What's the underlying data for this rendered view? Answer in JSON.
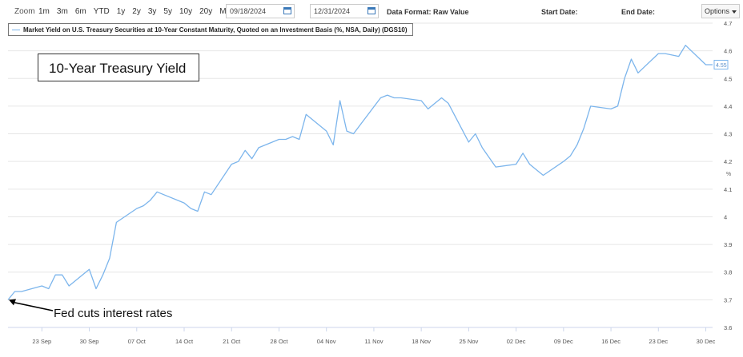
{
  "toolbar": {
    "zoom_label": "Zoom",
    "zoom_buttons": [
      "1m",
      "3m",
      "6m",
      "YTD",
      "1y",
      "2y",
      "3y",
      "5y",
      "10y",
      "20y",
      "Max"
    ],
    "start_date_value": "09/18/2024",
    "end_date_value": "12/31/2024",
    "data_format_label": "Data Format: Raw Value",
    "start_date_label": "Start Date:",
    "end_date_label": "End Date:",
    "options_label": "Options"
  },
  "annotations": {
    "title_box": "10-Year Treasury Yield",
    "fed_note": "Fed cuts interest rates"
  },
  "chart_data": {
    "type": "line",
    "title": "",
    "xlabel": "",
    "ylabel": "%",
    "ylim": [
      3.6,
      4.7
    ],
    "xlim": [
      "2024-09-18",
      "2024-12-31"
    ],
    "yticks": [
      "3.6",
      "3.7",
      "3.8",
      "3.9",
      "4",
      "4.1",
      "4.2",
      "4.3",
      "4.4",
      "4.5",
      "4.6",
      "4.7"
    ],
    "xticks": [
      {
        "date": "2024-09-23",
        "label": "23 Sep"
      },
      {
        "date": "2024-09-30",
        "label": "30 Sep"
      },
      {
        "date": "2024-10-07",
        "label": "07 Oct"
      },
      {
        "date": "2024-10-14",
        "label": "14 Oct"
      },
      {
        "date": "2024-10-21",
        "label": "21 Oct"
      },
      {
        "date": "2024-10-28",
        "label": "28 Oct"
      },
      {
        "date": "2024-11-04",
        "label": "04 Nov"
      },
      {
        "date": "2024-11-11",
        "label": "11 Nov"
      },
      {
        "date": "2024-11-18",
        "label": "18 Nov"
      },
      {
        "date": "2024-11-25",
        "label": "25 Nov"
      },
      {
        "date": "2024-12-02",
        "label": "02 Dec"
      },
      {
        "date": "2024-12-09",
        "label": "09 Dec"
      },
      {
        "date": "2024-12-16",
        "label": "16 Dec"
      },
      {
        "date": "2024-12-23",
        "label": "23 Dec"
      },
      {
        "date": "2024-12-30",
        "label": "30 Dec"
      }
    ],
    "last_value_label": "4.55",
    "series": [
      {
        "name": "Market Yield on U.S. Treasury Securities at 10-Year Constant Maturity, Quoted on an Investment Basis (%, NSA, Daily) (DGS10)",
        "color": "#7cb5ec",
        "points": [
          [
            "2024-09-18",
            3.7
          ],
          [
            "2024-09-19",
            3.73
          ],
          [
            "2024-09-20",
            3.73
          ],
          [
            "2024-09-23",
            3.75
          ],
          [
            "2024-09-24",
            3.74
          ],
          [
            "2024-09-25",
            3.79
          ],
          [
            "2024-09-26",
            3.79
          ],
          [
            "2024-09-27",
            3.75
          ],
          [
            "2024-09-30",
            3.81
          ],
          [
            "2024-10-01",
            3.74
          ],
          [
            "2024-10-02",
            3.79
          ],
          [
            "2024-10-03",
            3.85
          ],
          [
            "2024-10-04",
            3.98
          ],
          [
            "2024-10-07",
            4.03
          ],
          [
            "2024-10-08",
            4.04
          ],
          [
            "2024-10-09",
            4.06
          ],
          [
            "2024-10-10",
            4.09
          ],
          [
            "2024-10-14",
            4.05
          ],
          [
            "2024-10-15",
            4.03
          ],
          [
            "2024-10-16",
            4.02
          ],
          [
            "2024-10-17",
            4.09
          ],
          [
            "2024-10-18",
            4.08
          ],
          [
            "2024-10-21",
            4.19
          ],
          [
            "2024-10-22",
            4.2
          ],
          [
            "2024-10-23",
            4.24
          ],
          [
            "2024-10-24",
            4.21
          ],
          [
            "2024-10-25",
            4.25
          ],
          [
            "2024-10-28",
            4.28
          ],
          [
            "2024-10-29",
            4.28
          ],
          [
            "2024-10-30",
            4.29
          ],
          [
            "2024-10-31",
            4.28
          ],
          [
            "2024-11-01",
            4.37
          ],
          [
            "2024-11-04",
            4.31
          ],
          [
            "2024-11-05",
            4.26
          ],
          [
            "2024-11-06",
            4.42
          ],
          [
            "2024-11-07",
            4.31
          ],
          [
            "2024-11-08",
            4.3
          ],
          [
            "2024-11-12",
            4.43
          ],
          [
            "2024-11-13",
            4.44
          ],
          [
            "2024-11-14",
            4.43
          ],
          [
            "2024-11-15",
            4.43
          ],
          [
            "2024-11-18",
            4.42
          ],
          [
            "2024-11-19",
            4.39
          ],
          [
            "2024-11-20",
            4.41
          ],
          [
            "2024-11-21",
            4.43
          ],
          [
            "2024-11-22",
            4.41
          ],
          [
            "2024-11-25",
            4.27
          ],
          [
            "2024-11-26",
            4.3
          ],
          [
            "2024-11-27",
            4.25
          ],
          [
            "2024-11-29",
            4.18
          ],
          [
            "2024-12-02",
            4.19
          ],
          [
            "2024-12-03",
            4.23
          ],
          [
            "2024-12-04",
            4.19
          ],
          [
            "2024-12-05",
            4.17
          ],
          [
            "2024-12-06",
            4.15
          ],
          [
            "2024-12-09",
            4.2
          ],
          [
            "2024-12-10",
            4.22
          ],
          [
            "2024-12-11",
            4.26
          ],
          [
            "2024-12-12",
            4.32
          ],
          [
            "2024-12-13",
            4.4
          ],
          [
            "2024-12-16",
            4.39
          ],
          [
            "2024-12-17",
            4.4
          ],
          [
            "2024-12-18",
            4.5
          ],
          [
            "2024-12-19",
            4.57
          ],
          [
            "2024-12-20",
            4.52
          ],
          [
            "2024-12-23",
            4.59
          ],
          [
            "2024-12-24",
            4.59
          ],
          [
            "2024-12-26",
            4.58
          ],
          [
            "2024-12-27",
            4.62
          ],
          [
            "2024-12-30",
            4.55
          ],
          [
            "2024-12-31",
            4.55
          ]
        ]
      }
    ]
  }
}
